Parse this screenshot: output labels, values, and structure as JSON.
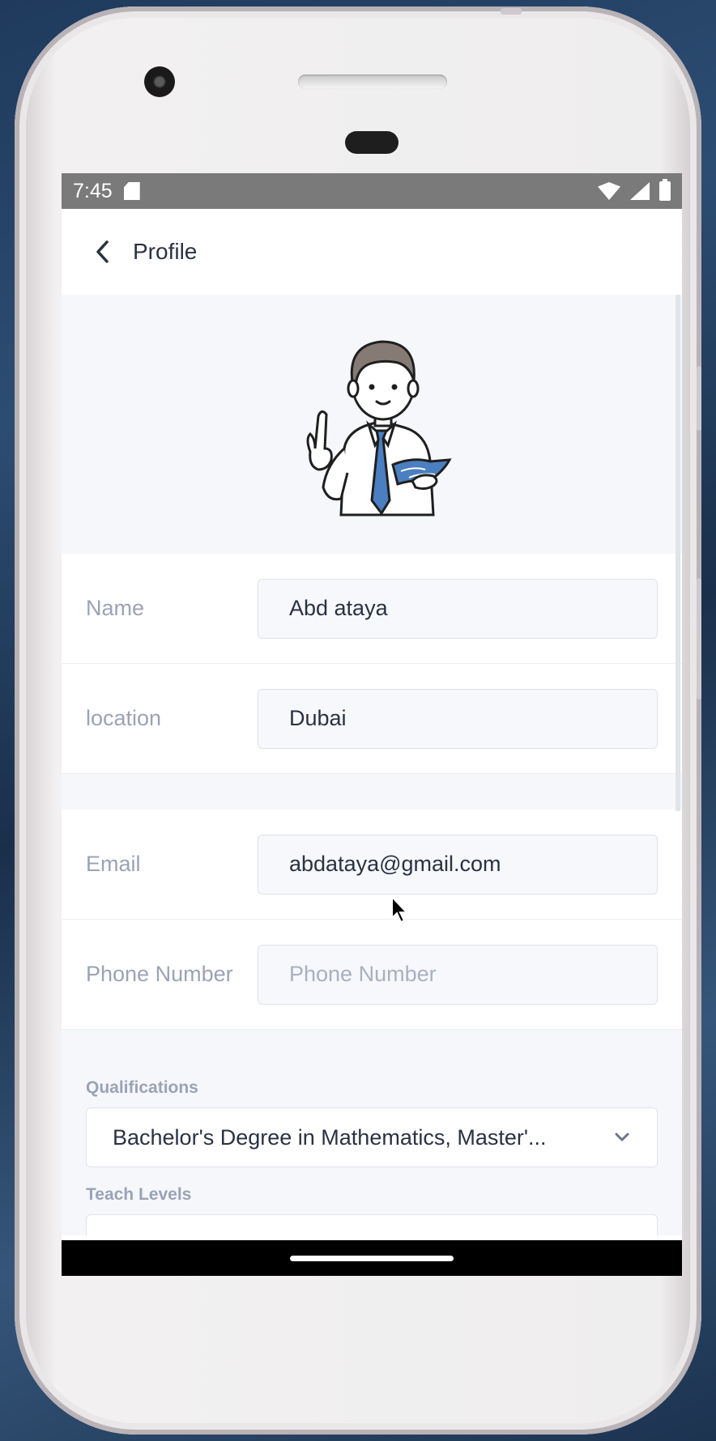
{
  "status_bar": {
    "time": "7:45"
  },
  "app_bar": {
    "title": "Profile"
  },
  "profile_fields": [
    {
      "label": "Name",
      "value": "Abd ataya",
      "placeholder": ""
    },
    {
      "label": "location",
      "value": "Dubai",
      "placeholder": ""
    }
  ],
  "contact_fields": [
    {
      "label": "Email",
      "value": "abdataya@gmail.com",
      "placeholder": ""
    },
    {
      "label": "Phone Number",
      "value": "",
      "placeholder": "Phone Number"
    }
  ],
  "qualifications": {
    "label": "Qualifications",
    "selected": "Bachelor's Degree in Mathematics, Master'..."
  },
  "teach_levels": {
    "label": "Teach Levels"
  },
  "icons": [
    "back-icon",
    "sd-card-icon",
    "wifi-icon",
    "signal-icon",
    "battery-icon",
    "chevron-down-icon",
    "teacher-illustration"
  ]
}
